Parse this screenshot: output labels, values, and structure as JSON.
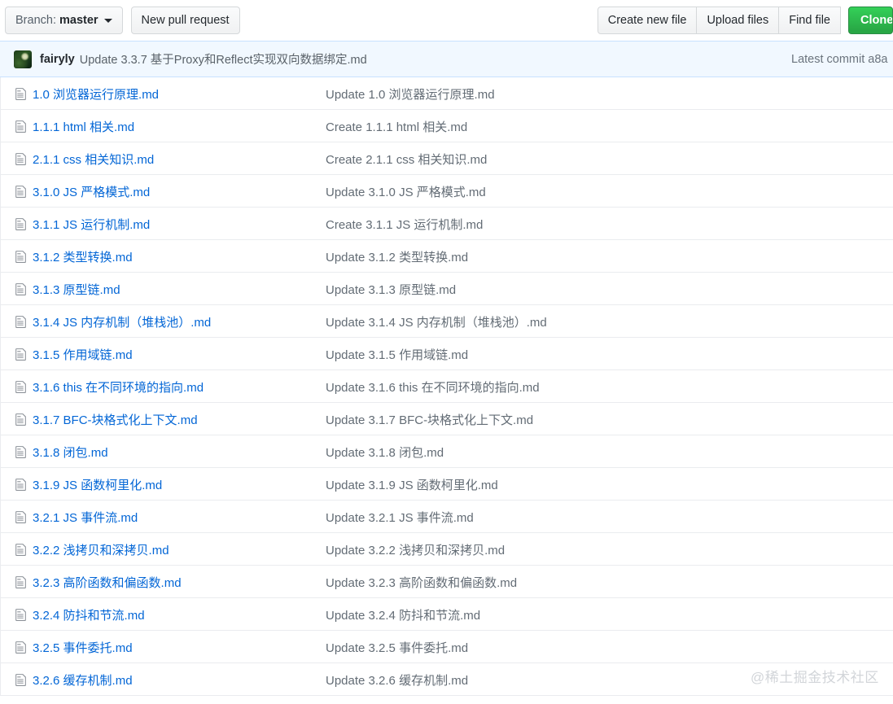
{
  "toolbar": {
    "branch_prefix": "Branch:",
    "branch_name": "master",
    "new_pull_request": "New pull request",
    "create_new_file": "Create new file",
    "upload_files": "Upload files",
    "find_file": "Find file",
    "clone_label": "Clone or download"
  },
  "commit_bar": {
    "author": "fairyly",
    "message": "Update 3.3.7 基于Proxy和Reflect实现双向数据绑定.md",
    "latest_commit_label": "Latest commit",
    "sha": "a8a"
  },
  "watermark": "@稀土掘金技术社区",
  "colors": {
    "link": "#0366d6",
    "commit_bar_bg": "#f1f8ff",
    "commit_bar_border": "#c8e1ff",
    "row_border": "#eaecef",
    "clone_green": "#2ea44f",
    "muted_text": "#6a737d"
  },
  "files": [
    {
      "icon": "file-icon",
      "name": "1.0 浏览器运行原理.md",
      "commit": "Update 1.0 浏览器运行原理.md"
    },
    {
      "icon": "file-icon",
      "name": "1.1.1 html 相关.md",
      "commit": "Create 1.1.1 html 相关.md"
    },
    {
      "icon": "file-icon",
      "name": "2.1.1 css 相关知识.md",
      "commit": "Create 2.1.1 css 相关知识.md"
    },
    {
      "icon": "file-icon",
      "name": "3.1.0 JS 严格模式.md",
      "commit": "Update 3.1.0 JS 严格模式.md"
    },
    {
      "icon": "file-icon",
      "name": "3.1.1 JS 运行机制.md",
      "commit": "Create 3.1.1 JS 运行机制.md"
    },
    {
      "icon": "file-icon",
      "name": "3.1.2 类型转换.md",
      "commit": "Update 3.1.2 类型转换.md"
    },
    {
      "icon": "file-icon",
      "name": "3.1.3 原型链.md",
      "commit": "Update 3.1.3 原型链.md"
    },
    {
      "icon": "file-icon",
      "name": "3.1.4 JS 内存机制（堆栈池）.md",
      "commit": "Update 3.1.4 JS 内存机制（堆栈池）.md"
    },
    {
      "icon": "file-icon",
      "name": "3.1.5 作用域链.md",
      "commit": "Update 3.1.5 作用域链.md"
    },
    {
      "icon": "file-icon",
      "name": "3.1.6 this 在不同环境的指向.md",
      "commit": "Update 3.1.6 this 在不同环境的指向.md"
    },
    {
      "icon": "file-icon",
      "name": "3.1.7 BFC-块格式化上下文.md",
      "commit": "Update 3.1.7 BFC-块格式化上下文.md"
    },
    {
      "icon": "file-icon",
      "name": "3.1.8 闭包.md",
      "commit": "Update 3.1.8 闭包.md"
    },
    {
      "icon": "file-icon",
      "name": "3.1.9 JS 函数柯里化.md",
      "commit": "Update 3.1.9 JS 函数柯里化.md"
    },
    {
      "icon": "file-icon",
      "name": "3.2.1 JS 事件流.md",
      "commit": "Update 3.2.1 JS 事件流.md"
    },
    {
      "icon": "file-icon",
      "name": "3.2.2 浅拷贝和深拷贝.md",
      "commit": "Update 3.2.2 浅拷贝和深拷贝.md"
    },
    {
      "icon": "file-icon",
      "name": "3.2.3 高阶函数和偏函数.md",
      "commit": "Update 3.2.3 高阶函数和偏函数.md"
    },
    {
      "icon": "file-icon",
      "name": "3.2.4 防抖和节流.md",
      "commit": "Update 3.2.4 防抖和节流.md"
    },
    {
      "icon": "file-icon",
      "name": "3.2.5 事件委托.md",
      "commit": "Update 3.2.5 事件委托.md"
    },
    {
      "icon": "file-icon",
      "name": "3.2.6 缓存机制.md",
      "commit": "Update 3.2.6 缓存机制.md"
    }
  ]
}
